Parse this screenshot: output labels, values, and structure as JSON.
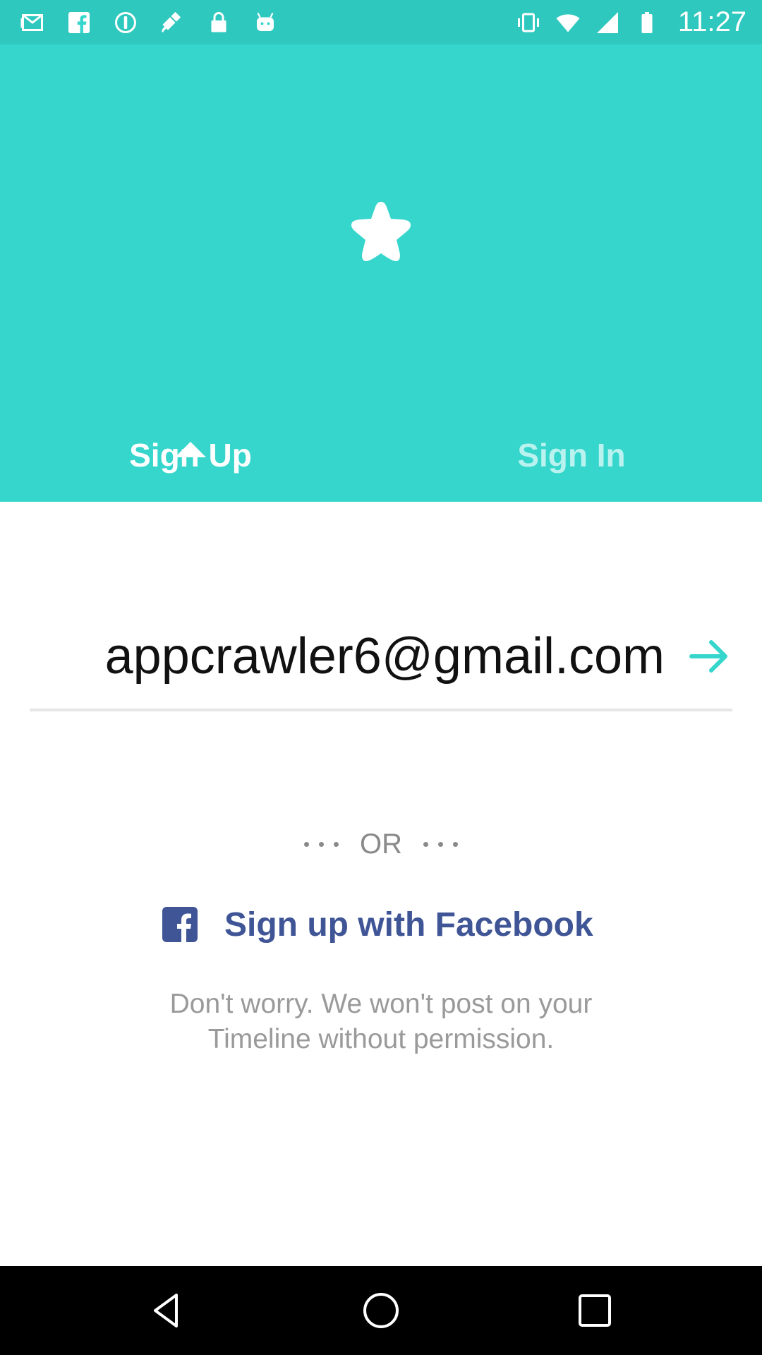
{
  "status_bar": {
    "time": "11:27",
    "left_icons": [
      "mail-icon",
      "facebook-icon",
      "sync-icon",
      "satellite-icon",
      "lock-icon",
      "android-icon"
    ],
    "right_icons": [
      "vibrate-icon",
      "wifi-icon",
      "signal-icon",
      "battery-icon"
    ]
  },
  "header": {
    "logo_icon": "star-icon",
    "background_color": "#36d6cd"
  },
  "tabs": {
    "signup_label": "Sign Up",
    "signin_label": "Sign In",
    "active": "Sign Up"
  },
  "email": {
    "value": "appcrawler6@gmail.com",
    "submit_icon": "arrow-right-icon",
    "accent_color": "#36d6cd"
  },
  "divider": {
    "label": "OR"
  },
  "facebook": {
    "button_label": "Sign up with Facebook",
    "icon": "facebook-icon",
    "color": "#3f5596"
  },
  "disclaimer": {
    "line1": "Don't worry. We won't post on your",
    "line2": "Timeline without permission."
  },
  "nav_bar": {
    "buttons": [
      "back-icon",
      "home-icon",
      "recents-icon"
    ]
  }
}
